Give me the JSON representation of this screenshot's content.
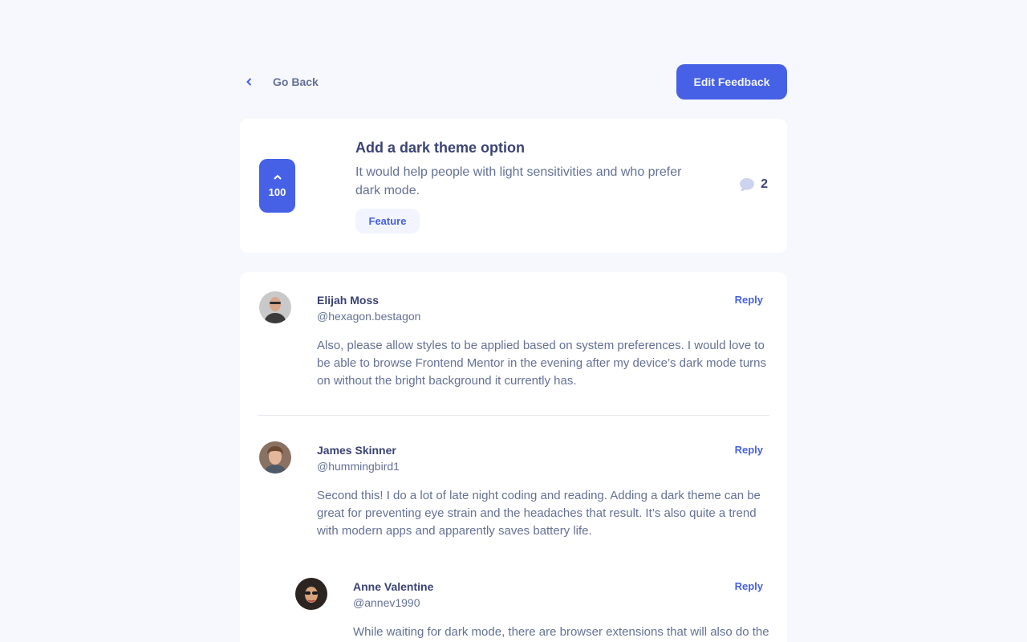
{
  "nav": {
    "back_label": "Go Back",
    "edit_label": "Edit Feedback"
  },
  "feedback": {
    "title": "Add a dark theme option",
    "description": "It would help people with light sensitivities and who prefer dark mode.",
    "upvotes": "100",
    "category": "Feature",
    "comment_count": "2"
  },
  "comments": [
    {
      "name": "Elijah Moss",
      "username": "@hexagon.bestagon",
      "reply_label": "Reply",
      "text": "Also, please allow styles to be applied based on system preferences. I would love to be able to browse Frontend Mentor in the evening after my device’s dark mode turns on without the bright background it currently has."
    },
    {
      "name": "James Skinner",
      "username": "@hummingbird1",
      "reply_label": "Reply",
      "text": "Second this! I do a lot of late night coding and reading. Adding a dark theme can be great for preventing eye strain and the headaches that result. It’s also quite a trend with modern apps and apparently saves battery life."
    },
    {
      "name": "Anne Valentine",
      "username": "@annev1990",
      "reply_label": "Reply",
      "text": "While waiting for dark mode, there are browser extensions that will also do the job."
    }
  ],
  "colors": {
    "primary": "#4661e6",
    "heading": "#3a4374",
    "body": "#647196",
    "background": "#f7f8fd",
    "tag_bg": "#f2f4ff"
  },
  "icons": {
    "back": "chevron-left-icon",
    "upvote": "chevron-up-icon",
    "comments": "speech-bubble-icon"
  }
}
